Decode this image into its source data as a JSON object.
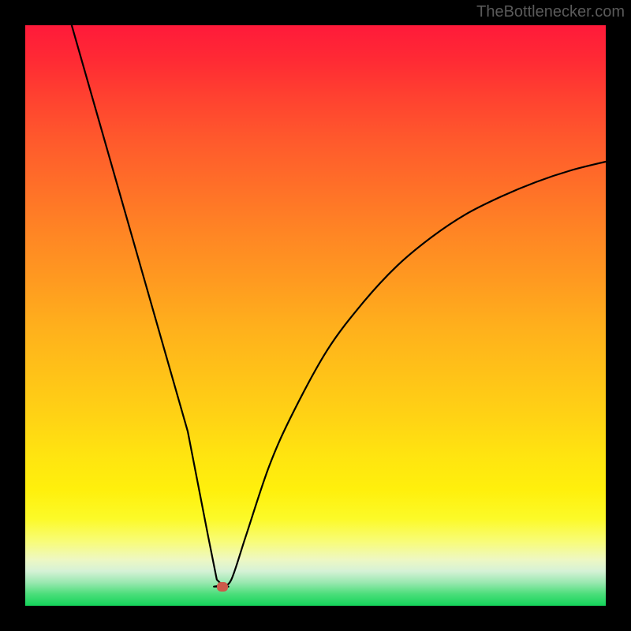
{
  "watermark": "TheBottlenecker.com",
  "chart_data": {
    "type": "line",
    "title": "",
    "xlabel": "",
    "ylabel": "",
    "xlim": [
      0,
      100
    ],
    "ylim": [
      0,
      100
    ],
    "background_gradient": {
      "top_color": "#ff1a3a",
      "bottom_color": "#14d45a",
      "description": "vertical gradient from red (top) through orange/yellow to green (bottom)"
    },
    "series": [
      {
        "name": "bottleneck-curve",
        "x": [
          8,
          12,
          16,
          20,
          24,
          28,
          31.5,
          33,
          34,
          35.5,
          38,
          42,
          46,
          52,
          58,
          64,
          70,
          76,
          82,
          88,
          94,
          100
        ],
        "y": [
          100,
          86,
          72,
          58,
          44,
          30,
          12,
          4.5,
          3.5,
          4.5,
          12,
          24,
          33,
          44,
          52,
          58.5,
          63.5,
          67.5,
          70.5,
          73,
          75,
          76.5
        ]
      }
    ],
    "marker": {
      "name": "optimal-point",
      "x": 34,
      "y": 3.2,
      "color": "#cc5a4a"
    }
  }
}
